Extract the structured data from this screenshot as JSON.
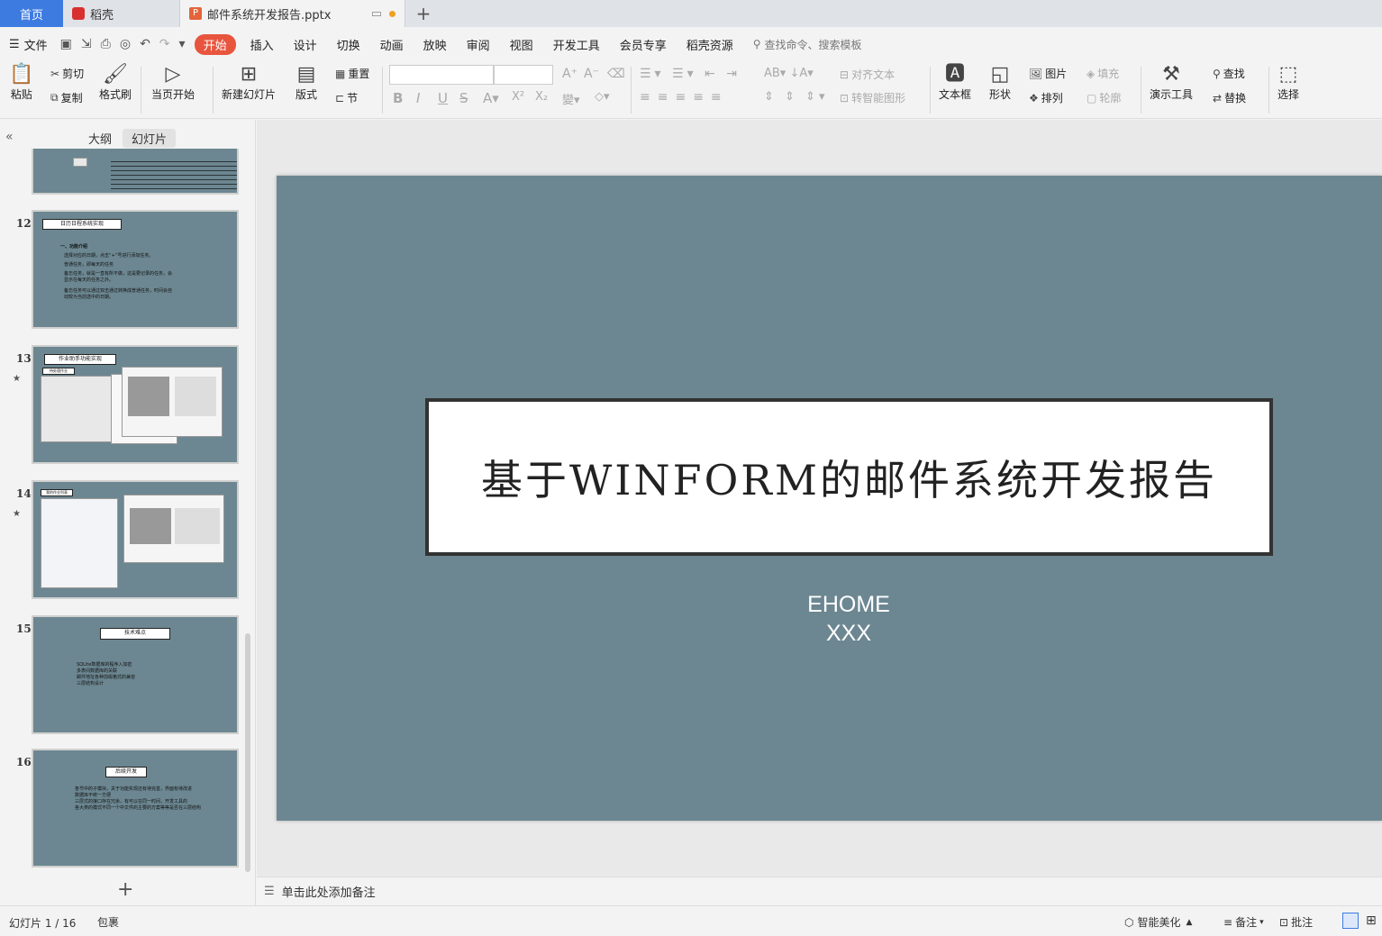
{
  "tabs": {
    "home": "首页",
    "app": "稻壳",
    "doc": "邮件系统开发报告.pptx",
    "add": "+"
  },
  "menu": {
    "file": "文件",
    "items": [
      "开始",
      "插入",
      "设计",
      "切换",
      "动画",
      "放映",
      "审阅",
      "视图",
      "开发工具",
      "会员专享",
      "稻壳资源"
    ],
    "active": "开始",
    "search": "查找命令、搜索模板"
  },
  "ribbon": {
    "paste": "粘贴",
    "cut": "剪切",
    "copy": "复制",
    "format_painter": "格式刷",
    "from_current": "当页开始",
    "new_slide": "新建幻灯片",
    "layout": "版式",
    "reset": "重置",
    "section": "节",
    "align_text": "对齐文本",
    "smart_shape": "转智能图形",
    "textbox": "文本框",
    "shape": "形状",
    "picture": "图片",
    "arrange": "排列",
    "fill": "填充",
    "outline": "轮廓",
    "present_tools": "演示工具",
    "find": "查找",
    "replace": "替换",
    "select": "选择"
  },
  "left_panel": {
    "tab_outline": "大纲",
    "tab_slides": "幻灯片",
    "slides": [
      {
        "num": "12",
        "title": "日历日程系统实现",
        "heading": "一、功能介绍",
        "lines": [
          "选择对应的日期，点击“+”号进行添加任务。",
          "普通任务，即每天的任务",
          "备忘任务，就是一直有所不做，这是要记录的任务，会",
          "显示在每天的任务之外。",
          "备忘任务可以通过双击通过转换成普通任务，时间会自",
          "动较为当前选中的日期。"
        ]
      },
      {
        "num": "13",
        "title": "作业助手功能实现",
        "label": "待处理作业"
      },
      {
        "num": "14",
        "title": "我的作业列表"
      },
      {
        "num": "15",
        "title": "技术难点",
        "lines": [
          "SQLite数据库的程序入加密",
          "多表间数据库的关联",
          "邮件地址各种前缀格式的兼容",
          "三层结构设计"
        ]
      },
      {
        "num": "16",
        "title": "后续开发",
        "lines": [
          "各节中的子模块，关于功能实现还有待完善，界面有待改进",
          "数据库不统一方便",
          "三层式的接口存在冗余，有可以在同一时间，开发工具的",
          "各大类的模式不同一个中文件的主要的方案等等是否在三层结构"
        ]
      }
    ],
    "add_slide": "+"
  },
  "slide": {
    "title": "基于WINFORM的邮件系统开发报告",
    "subtitle_line1": "EHOME",
    "subtitle_line2": "XXX"
  },
  "notes": {
    "placeholder": "单击此处添加备注"
  },
  "status": {
    "slide_counter": "幻灯片 1 / 16",
    "theme": "包裹",
    "beautify": "智能美化",
    "notes": "备注",
    "comments": "批注"
  },
  "colors": {
    "slide_bg": "#6c8791",
    "accent": "#e8553e",
    "home_tab": "#3e7be0"
  }
}
